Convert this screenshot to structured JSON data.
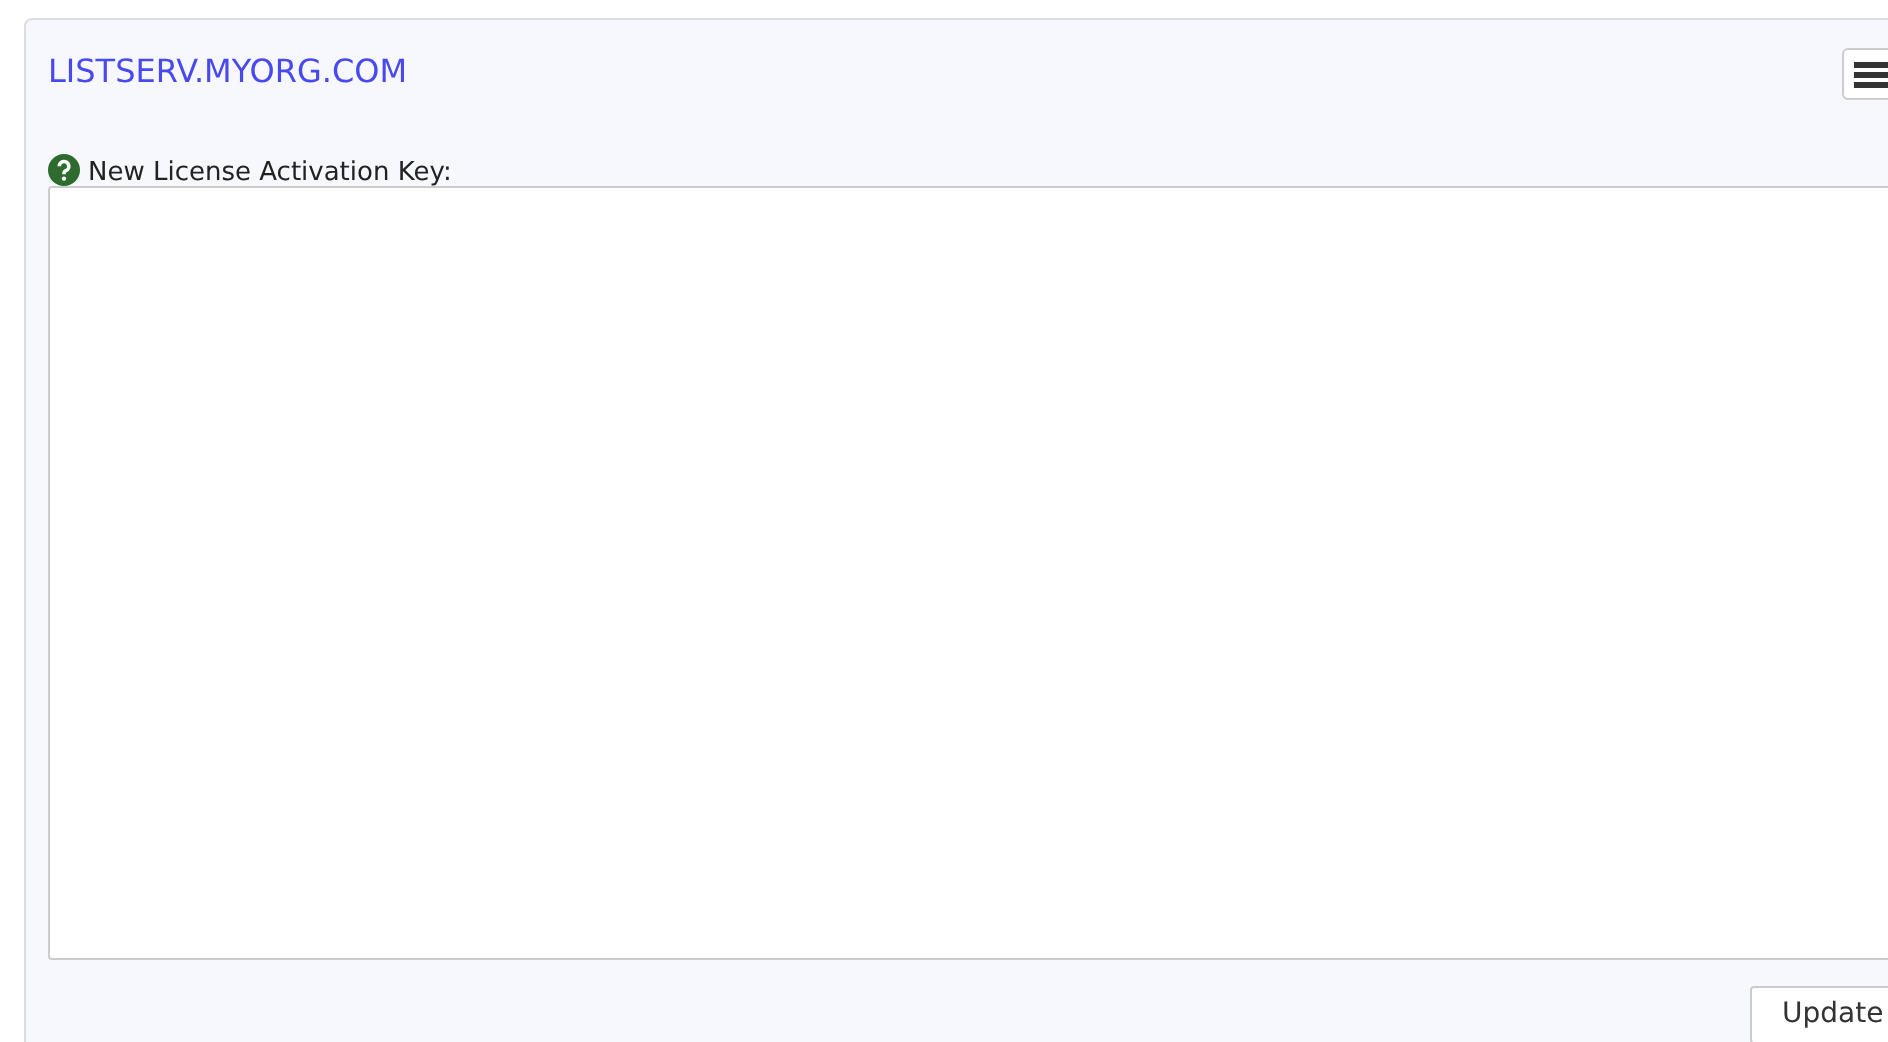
{
  "header": {
    "title": "LISTSERV.MYORG.COM"
  },
  "field": {
    "label": "New License Activation Key:"
  },
  "buttons": [
    {
      "label": "Update"
    }
  ]
}
